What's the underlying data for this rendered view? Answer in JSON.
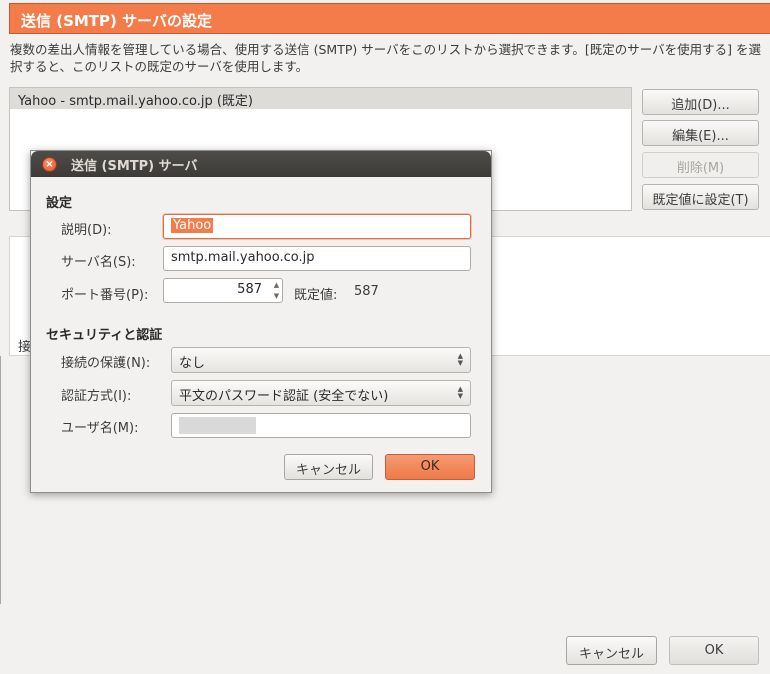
{
  "outer": {
    "title": "送信 (SMTP) サーバの設定",
    "description": "複数の差出人情報を管理している場合、使用する送信 (SMTP) サーバをこのリストから選択できます。[既定のサーバを使用する] を選択すると、このリストの既定のサーバを使用します。",
    "server_list": [
      {
        "label": "Yahoo - smtp.mail.yahoo.co.jp (既定)"
      }
    ],
    "buttons": {
      "add": "追加(D)...",
      "edit": "編集(E)...",
      "delete": "削除(M)",
      "set_default": "既定値に設定(T)"
    },
    "details_label_partial": "接",
    "cancel": "キャンセル",
    "ok": "OK"
  },
  "dialog": {
    "title": "送信 (SMTP) サーバ",
    "settings_header": "設定",
    "description_label": "説明(D):",
    "description_value": "Yahoo",
    "server_label": "サーバ名(S):",
    "server_value": "smtp.mail.yahoo.co.jp",
    "port_label": "ポート番号(P):",
    "port_value": "587",
    "default_port_label": "既定値:",
    "default_port_value": "587",
    "security_header": "セキュリティと認証",
    "connection_security_label": "接続の保護(N):",
    "connection_security_value": "なし",
    "auth_method_label": "認証方式(I):",
    "auth_method_value": "平文のパスワード認証 (安全でない)",
    "username_label": "ユーザ名(M):",
    "username_value": "",
    "cancel": "キャンセル",
    "ok": "OK"
  },
  "colors": {
    "accent": "#f37c4a",
    "dialog_titlebar": "#3c3b37",
    "selection": "#f37c4a"
  }
}
